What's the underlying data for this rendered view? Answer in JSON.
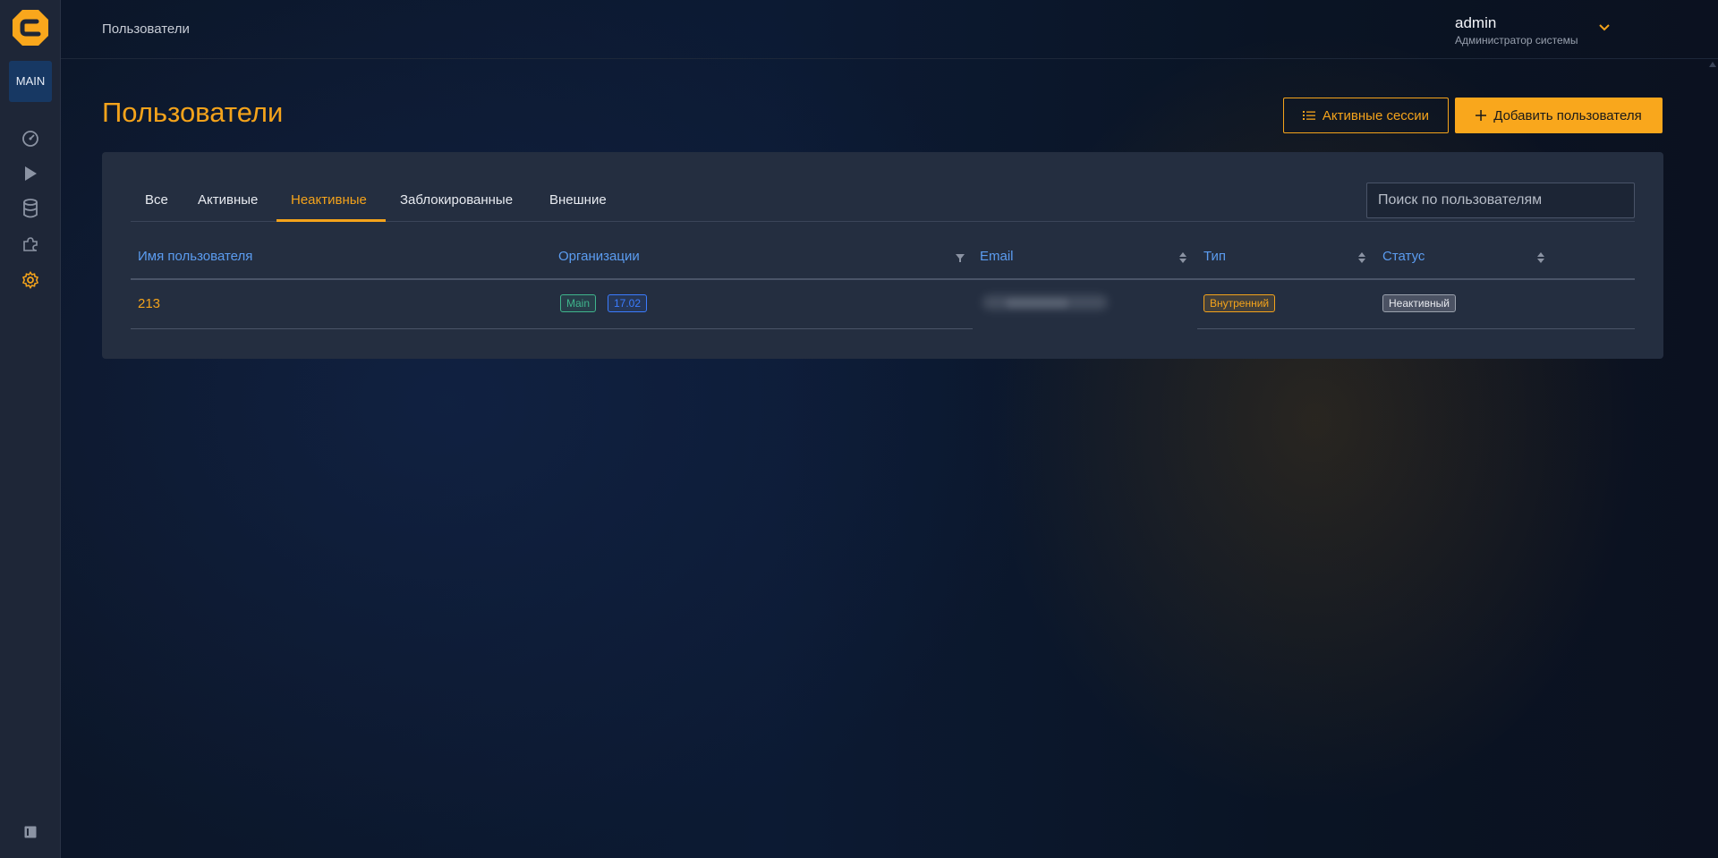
{
  "sidebar": {
    "org_label": "MAIN",
    "items": [
      {
        "name": "dashboard-icon",
        "active": false
      },
      {
        "name": "play-icon",
        "active": false
      },
      {
        "name": "database-icon",
        "active": false
      },
      {
        "name": "puzzle-icon",
        "active": false
      },
      {
        "name": "gear-icon",
        "active": true
      }
    ],
    "collapse_icon": "sidebar-collapse-icon"
  },
  "header": {
    "breadcrumb": "Пользователи",
    "user_name": "admin",
    "user_role": "Администратор системы"
  },
  "page": {
    "title": "Пользователи",
    "active_sessions_label": "Активные сессии",
    "add_user_label": "Добавить пользователя"
  },
  "tabs": [
    {
      "label": "Все",
      "active": false
    },
    {
      "label": "Активные",
      "active": false
    },
    {
      "label": "Неактивные",
      "active": true
    },
    {
      "label": "Заблокированные",
      "active": false
    },
    {
      "label": "Внешние",
      "active": false
    }
  ],
  "search": {
    "placeholder": "Поиск по пользователям",
    "value": ""
  },
  "table": {
    "columns": [
      {
        "label": "Имя пользователя",
        "icon": ""
      },
      {
        "label": "Организации",
        "icon": "filter-icon"
      },
      {
        "label": "Email",
        "icon": "sort-icon"
      },
      {
        "label": "Тип",
        "icon": "sort-icon"
      },
      {
        "label": "Статус",
        "icon": "sort-icon"
      }
    ],
    "rows": [
      {
        "username": "213",
        "organizations": [
          "Main",
          "17.02"
        ],
        "email": "",
        "type": "Внутренний",
        "status": "Неактивный"
      }
    ]
  },
  "colors": {
    "accent": "#f4a31b",
    "link_blue": "#5b9cf0",
    "panel": "#242e40",
    "sidebar": "#1e2637",
    "tag_green": "#3fb58c",
    "tag_blue": "#3b7cff"
  }
}
